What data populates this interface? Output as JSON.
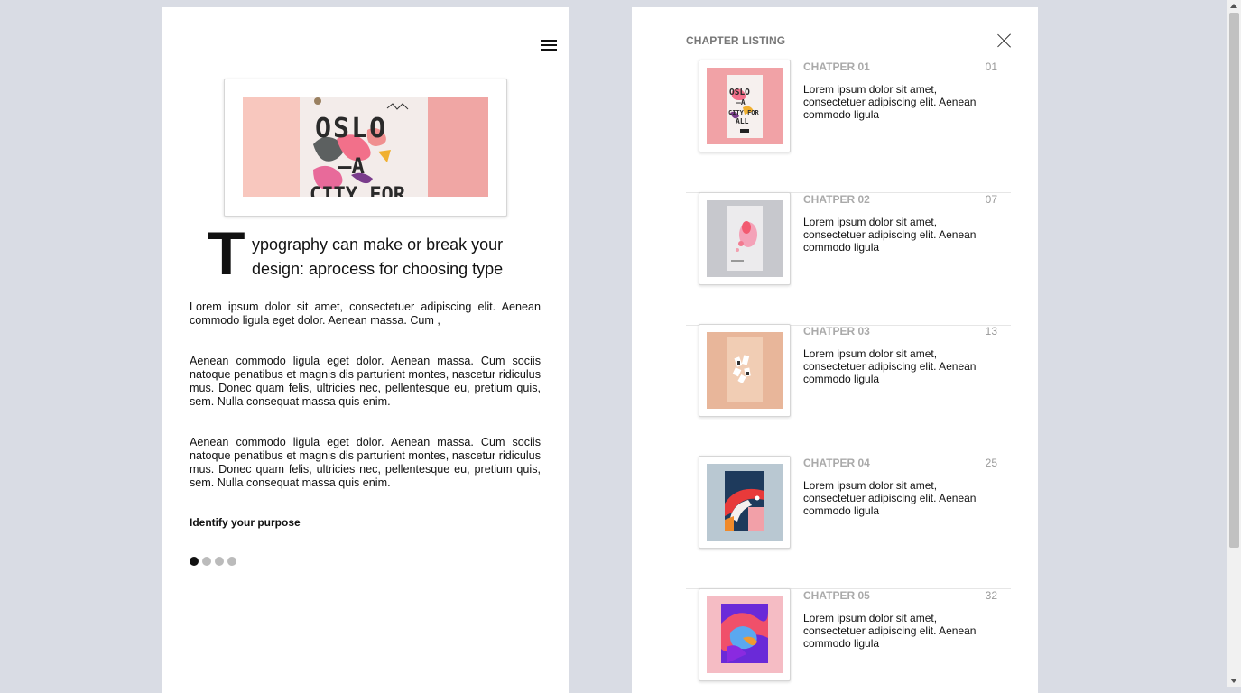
{
  "article": {
    "dropcap": "T",
    "title": "ypography can make or break your design: aprocess for choosing type",
    "paragraphs": [
      "Lorem ipsum dolor sit amet, consectetuer adipiscing elit. Aenean commodo ligula eget dolor. Aenean massa. Cum ,",
      "Aenean commodo ligula eget dolor. Aenean massa. Cum sociis natoque penatibus et magnis dis parturient montes, nascetur ridiculus mus. Donec quam felis, ultricies nec, pellentesque eu, pretium quis, sem. Nulla consequat massa quis enim.",
      "Aenean commodo ligula eget dolor. Aenean massa. Cum sociis natoque penatibus et magnis dis parturient montes, nascetur ridiculus mus. Donec quam felis, ultricies nec, pellentesque eu, pretium quis, sem. Nulla consequat massa quis enim."
    ],
    "subheading": "Identify your purpose",
    "hero_lettering": [
      "OSLO",
      "—A",
      "CITY FOR"
    ],
    "pagination": {
      "total": 4,
      "active_index": 0
    }
  },
  "icons": {
    "menu": "hamburger-menu-icon",
    "close": "close-icon"
  },
  "listing": {
    "header": "CHAPTER LISTING",
    "chapters": [
      {
        "label": "CHATPER 01",
        "page": "01",
        "description": "Lorem ipsum dolor sit amet, consectetuer adipiscing elit. Aenean commodo ligula",
        "thumb_lettering": [
          "OSLO",
          "—A",
          "CITY FOR",
          "ALL"
        ]
      },
      {
        "label": "CHATPER 02",
        "page": "07",
        "description": "Lorem ipsum dolor sit amet, consectetuer adipiscing elit. Aenean commodo ligula"
      },
      {
        "label": "CHATPER 03",
        "page": "13",
        "description": "Lorem ipsum dolor sit amet, consectetuer adipiscing elit. Aenean commodo ligula"
      },
      {
        "label": "CHATPER 04",
        "page": "25",
        "description": "Lorem ipsum dolor sit amet, consectetuer adipiscing elit. Aenean commodo ligula"
      },
      {
        "label": "CHATPER 05",
        "page": "32",
        "description": "Lorem ipsum dolor sit amet, consectetuer adipiscing elit. Aenean commodo ligula"
      }
    ]
  },
  "colors": {
    "background": "#d9dce4",
    "panel": "#ffffff",
    "muted_label": "#aaaaaa",
    "active_dot": "#111111",
    "inactive_dot": "#bbbbbb"
  }
}
